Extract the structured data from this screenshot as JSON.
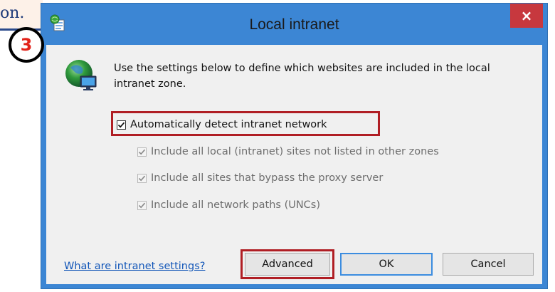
{
  "background_page": {
    "fragment_text": "on."
  },
  "step": {
    "number": "3"
  },
  "window": {
    "title": "Local intranet",
    "close_label": "×",
    "title_icon": "intranet-settings-icon"
  },
  "dialog": {
    "globe_icon": "globe-network-icon",
    "intro": "Use the settings below to define which websites are included in the local intranet zone.",
    "auto_detect": {
      "label": "Automatically detect intranet network",
      "checked": true
    },
    "options": [
      {
        "label": "Include all local (intranet) sites not listed in other zones",
        "checked": true,
        "enabled": false
      },
      {
        "label": "Include all sites that bypass the proxy server",
        "checked": true,
        "enabled": false
      },
      {
        "label": "Include all network paths (UNCs)",
        "checked": true,
        "enabled": false
      }
    ],
    "help_link": "What are intranet settings?",
    "buttons": {
      "advanced": "Advanced",
      "ok": "OK",
      "cancel": "Cancel"
    }
  },
  "colors": {
    "frame": "#3c86d4",
    "close": "#c7383e",
    "highlight": "#b01e24",
    "link": "#1256b8",
    "step_number": "#e2231a"
  }
}
